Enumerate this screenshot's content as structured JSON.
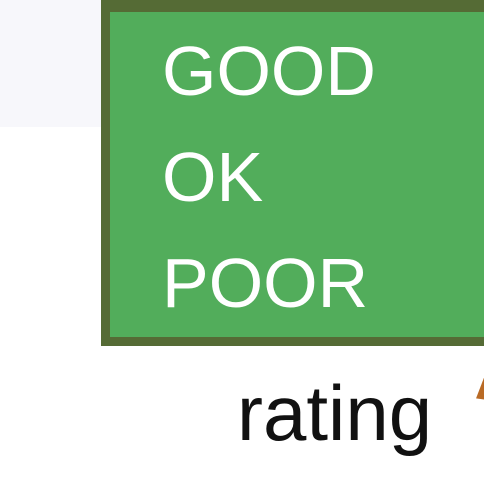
{
  "options": [
    "GOOD",
    "OK",
    "POOR"
  ],
  "caption": "rating",
  "colors": {
    "box_fill": "#52ad5b",
    "box_border": "#556b35",
    "text": "#ffffff",
    "caption": "#111111",
    "arrow": "#b96a25"
  }
}
